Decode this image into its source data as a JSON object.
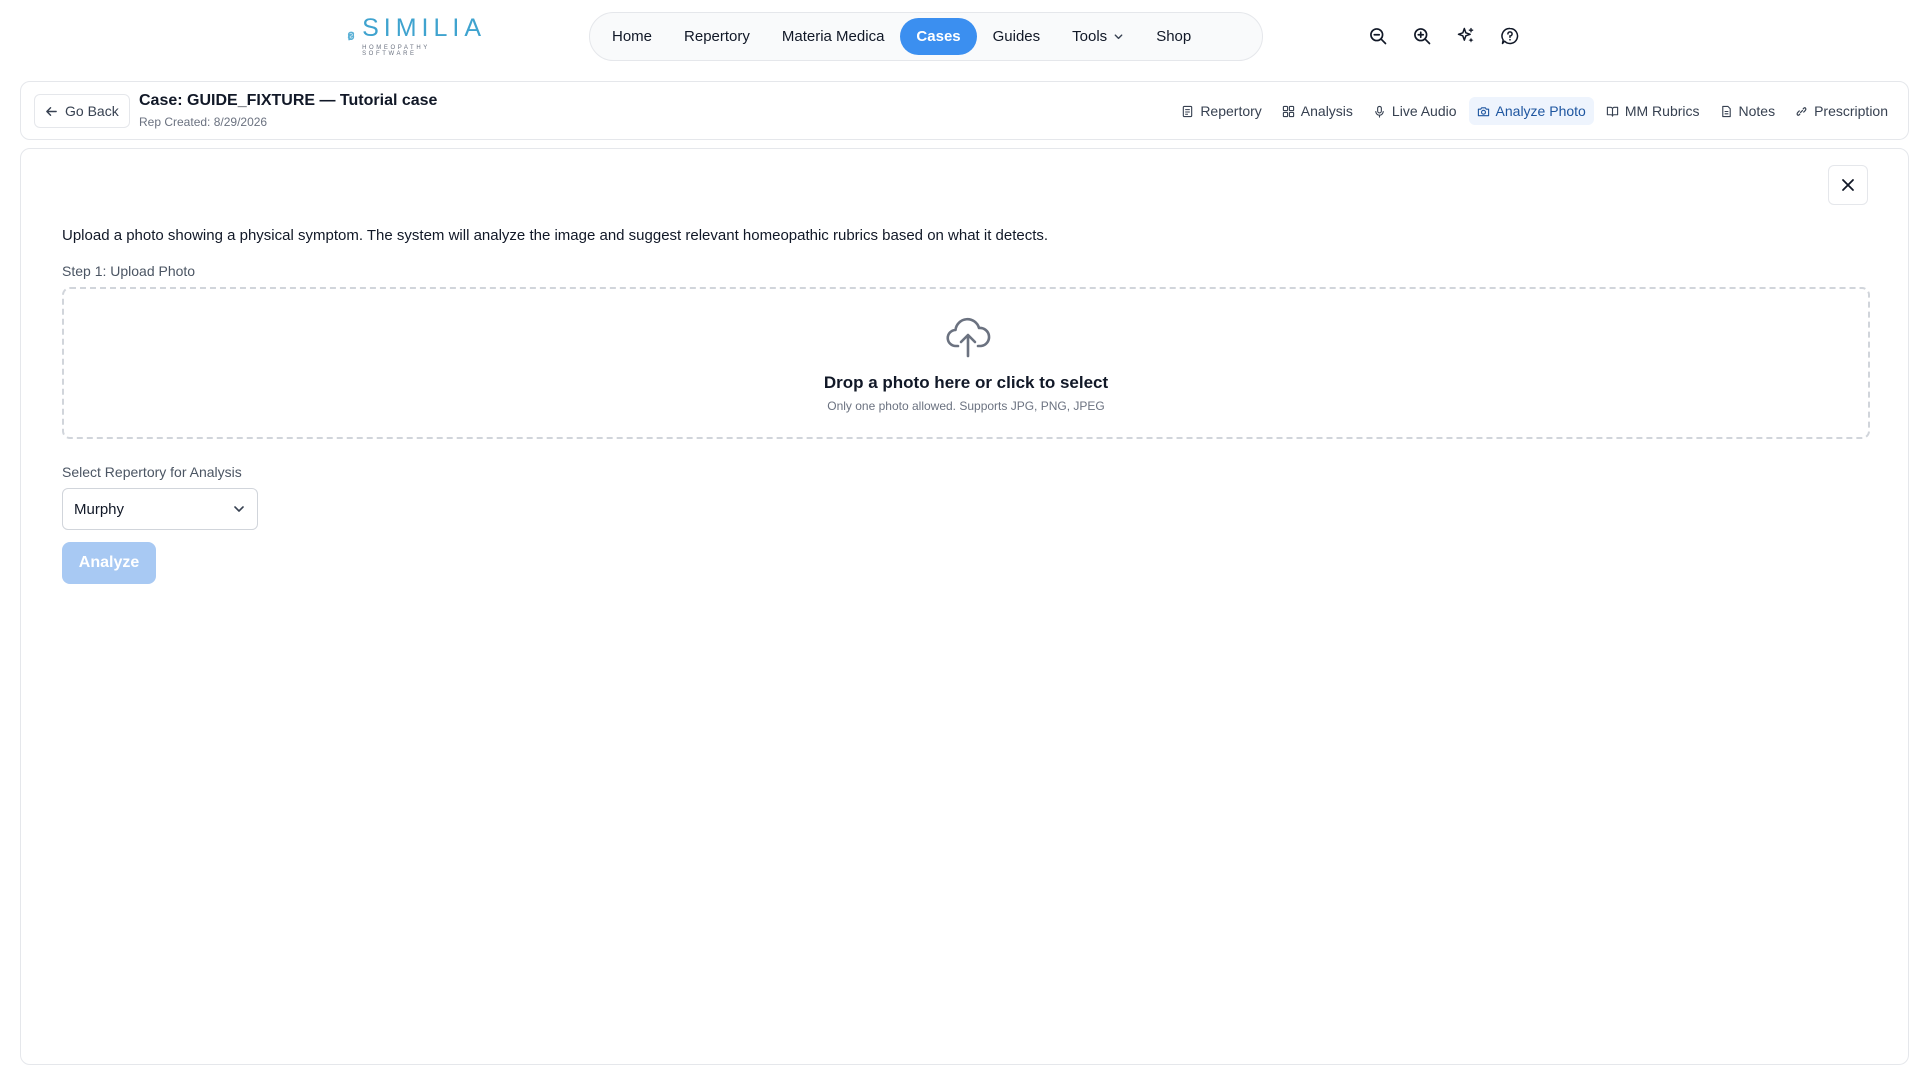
{
  "brand": {
    "name": "SIMILIA",
    "tagline": "HOMEOPATHY SOFTWARE",
    "color": "#3fa3cf"
  },
  "nav": {
    "items": [
      {
        "label": "Home",
        "active": false
      },
      {
        "label": "Repertory",
        "active": false
      },
      {
        "label": "Materia Medica",
        "active": false
      },
      {
        "label": "Cases",
        "active": true
      },
      {
        "label": "Guides",
        "active": false
      },
      {
        "label": "Tools",
        "active": false
      },
      {
        "label": "Shop",
        "active": false
      }
    ],
    "active_color": "#3b8ff0"
  },
  "tools": [
    "zoom-out-icon",
    "zoom-in-icon",
    "sparkles-icon",
    "help-icon"
  ],
  "case": {
    "back_label": "Go Back",
    "title": "Case: GUIDE_FIXTURE — Tutorial case",
    "subtitle": "Rep Created: 8/29/2026",
    "tabs": [
      {
        "label": "Repertory",
        "icon": "document-icon",
        "active": false
      },
      {
        "label": "Analysis",
        "icon": "grid-icon",
        "active": false
      },
      {
        "label": "Live Audio",
        "icon": "microphone-icon",
        "active": false
      },
      {
        "label": "Analyze Photo",
        "icon": "camera-icon",
        "active": true
      },
      {
        "label": "MM Rubrics",
        "icon": "book-icon",
        "active": false
      },
      {
        "label": "Notes",
        "icon": "notes-icon",
        "active": false
      },
      {
        "label": "Prescription",
        "icon": "link-icon",
        "active": false
      }
    ]
  },
  "photo": {
    "intro": "Upload a photo showing a physical symptom. The system will analyze the image and suggest relevant homeopathic rubrics based on what it detects.",
    "step_label": "Step 1: Upload Photo",
    "dropzone_title": "Drop a photo here or click to select",
    "dropzone_sub": "Only one photo allowed. Supports JPG, PNG, JPEG",
    "select_label": "Select Repertory for Analysis",
    "selected_repertory": "Murphy",
    "analyze_label": "Analyze",
    "analyze_disabled": true
  }
}
